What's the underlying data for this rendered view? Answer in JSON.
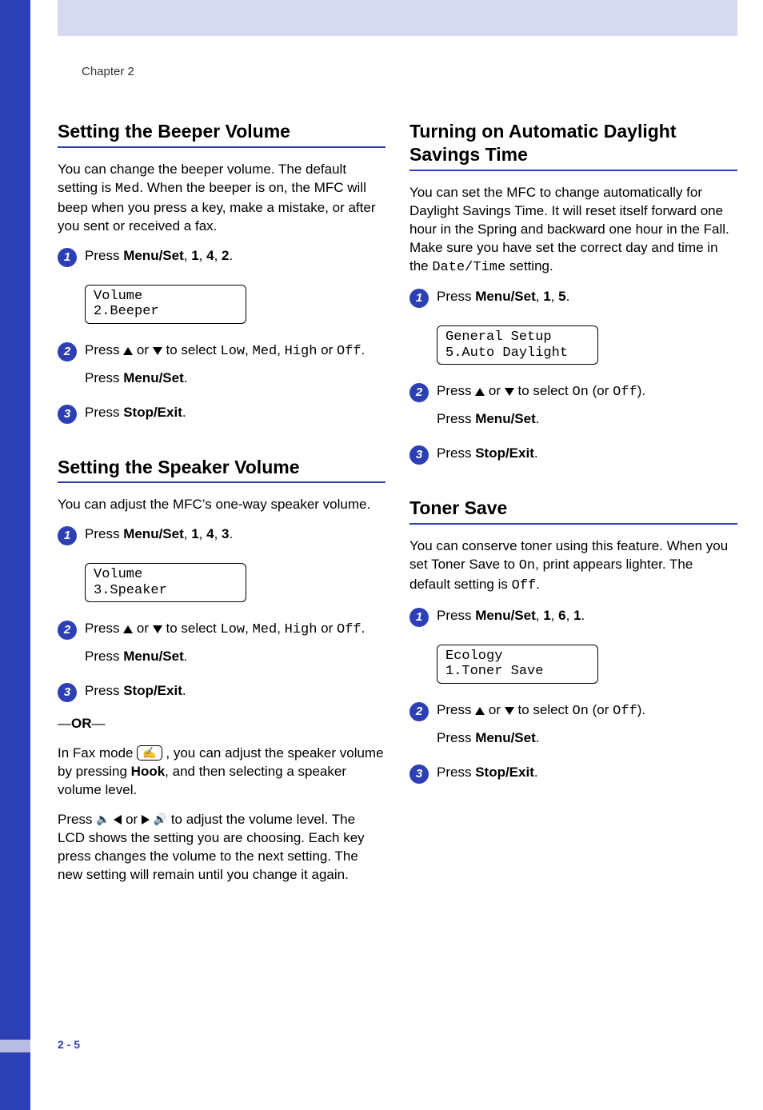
{
  "chapter": "Chapter 2",
  "page_num": "2 - 5",
  "left": {
    "beeper": {
      "title": "Setting the Beeper Volume",
      "intro_a": "You can change the beeper volume. The default setting is ",
      "intro_code1": "Med",
      "intro_b": ". When the beeper is on, the MFC will beep when you press a key, make a mistake, or after you sent or received a fax.",
      "step1_a": "Press ",
      "step1_b": "Menu/Set",
      "step1_c": ", ",
      "step1_d": "1",
      "step1_e": ", ",
      "step1_f": "4",
      "step1_g": ", ",
      "step1_h": "2",
      "step1_i": ".",
      "lcd": "Volume\n2.Beeper",
      "step2_a": "Press ",
      "step2_b": " or ",
      "step2_c": " to select ",
      "opt_low": "Low",
      "sep1": ", ",
      "opt_med": "Med",
      "sep2": ", ",
      "opt_high": "High",
      "step2_d": " or ",
      "opt_off": "Off",
      "step2_e": ".",
      "step2_f": "Press ",
      "step2_g": "Menu/Set",
      "step2_h": ".",
      "step3_a": "Press ",
      "step3_b": "Stop/Exit",
      "step3_c": "."
    },
    "speaker": {
      "title": "Setting the Speaker Volume",
      "intro": "You can adjust the MFC’s one-way speaker volume.",
      "step1_a": "Press ",
      "step1_b": "Menu/Set",
      "step1_c": ", ",
      "step1_d": "1",
      "step1_e": ", ",
      "step1_f": "4",
      "step1_g": ", ",
      "step1_h": "3",
      "step1_i": ".",
      "lcd": "Volume\n3.Speaker",
      "step2_a": "Press ",
      "step2_b": " or ",
      "step2_c": " to select ",
      "opt_low": "Low",
      "sep1": ", ",
      "opt_med": "Med",
      "sep2": ", ",
      "opt_high": "High",
      "step2_d": " or ",
      "opt_off": "Off",
      "step2_e": ".",
      "step2_f": "Press ",
      "step2_g": "Menu/Set",
      "step2_h": ".",
      "step3_a": "Press ",
      "step3_b": "Stop/Exit",
      "step3_c": ".",
      "or_a": "—",
      "or_b": "OR",
      "or_c": "—",
      "fax_a": "In Fax mode ",
      "fax_b": " , you can adjust the speaker volume by pressing ",
      "fax_c": "Hook",
      "fax_d": ", and then selecting a speaker volume level.",
      "vol_a": "Press ",
      "vol_b": "  or  ",
      "vol_c": " to adjust the volume level. The LCD shows the setting you are choosing. Each key press changes the volume to the next setting. The new setting will remain until you change it again."
    }
  },
  "right": {
    "daylight": {
      "title": "Turning on Automatic Daylight Savings Time",
      "intro_a": "You can set the MFC to change automatically for Daylight Savings Time. It will reset itself forward one hour in the Spring and backward one hour in the Fall. Make sure you have set the correct day and time in the ",
      "intro_code": "Date/Time",
      "intro_b": " setting.",
      "step1_a": "Press ",
      "step1_b": "Menu/Set",
      "step1_c": ", ",
      "step1_d": "1",
      "step1_e": ", ",
      "step1_f": "5",
      "step1_g": ".",
      "lcd": "General Setup\n5.Auto Daylight",
      "step2_a": "Press ",
      "step2_b": " or ",
      "step2_c": " to select ",
      "opt_on": "On",
      "step2_d": " (or ",
      "opt_off": "Off",
      "step2_e": ").",
      "step2_f": "Press ",
      "step2_g": "Menu/Set",
      "step2_h": ".",
      "step3_a": "Press ",
      "step3_b": "Stop/Exit",
      "step3_c": "."
    },
    "toner": {
      "title": "Toner Save",
      "intro_a": "You can conserve toner using this feature. When you set Toner Save to ",
      "intro_code1": "On",
      "intro_b": ", print appears lighter. The default setting is ",
      "intro_code2": "Off",
      "intro_c": ".",
      "step1_a": "Press ",
      "step1_b": "Menu/Set",
      "step1_c": ", ",
      "step1_d": "1",
      "step1_e": ", ",
      "step1_f": "6",
      "step1_g": ", ",
      "step1_h": "1",
      "step1_i": ".",
      "lcd": "Ecology\n1.Toner Save",
      "step2_a": "Press ",
      "step2_b": " or ",
      "step2_c": " to select ",
      "opt_on": "On",
      "step2_d": " (or ",
      "opt_off": "Off",
      "step2_e": ").",
      "step2_f": "Press ",
      "step2_g": "Menu/Set",
      "step2_h": ".",
      "step3_a": "Press ",
      "step3_b": "Stop/Exit",
      "step3_c": "."
    }
  }
}
